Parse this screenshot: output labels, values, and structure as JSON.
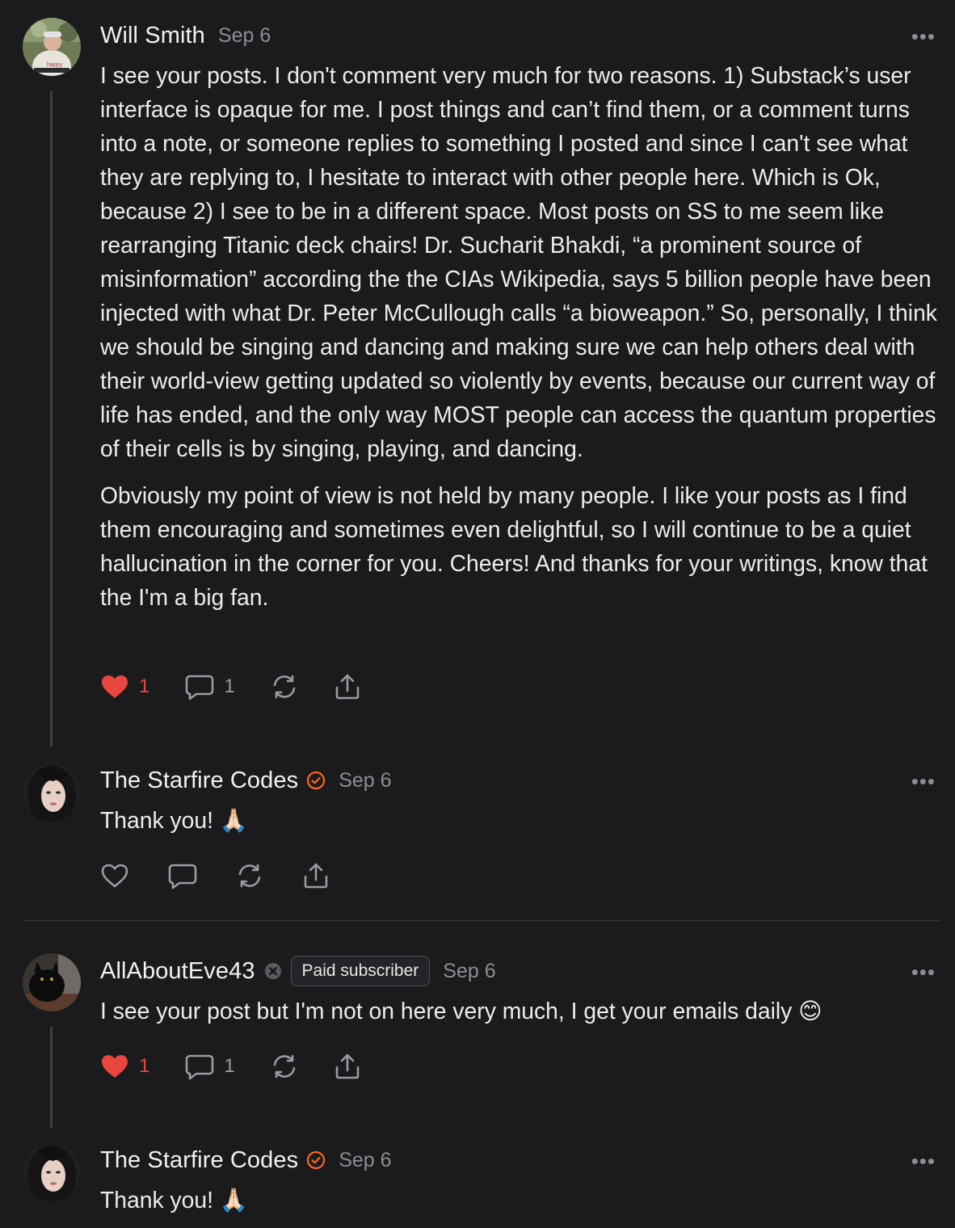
{
  "comments": [
    {
      "author": "Will Smith",
      "date": "Sep 6",
      "more": "•••",
      "paragraphs": [
        "I see your posts. I don't comment very much for two reasons. 1) Substack’s user interface is opaque for me. I post things and can’t find them, or a comment turns into a note, or someone replies to something I posted and since I can't see what they are replying to, I hesitate to interact with other people here. Which is Ok, because 2) I see to be in a different space. Most posts on SS to me seem like rearranging Titanic deck chairs! Dr. Sucharit Bhakdi, “a prominent source of misinformation” according the the CIAs Wikipedia, says 5 billion people have been injected with what Dr. Peter McCullough calls “a bioweapon.” So, personally, I think we should be singing and dancing and making sure we can help others deal with their world-view getting updated so violently by events, because our current way of life has ended, and the only way MOST people can access the quantum properties of their cells is by singing, playing, and dancing.",
        "Obviously my point of view is not held by many people. I like your posts as I find them encouraging and sometimes even delightful, so I will continue to be a quiet hallucination in the corner for you. Cheers! And thanks for your writings, know that the I'm a big fan."
      ],
      "likes": "1",
      "replies": "1",
      "liked": true
    },
    {
      "author": "The Starfire Codes",
      "date": "Sep 6",
      "more": "•••",
      "text": "Thank you! 🙏🏻",
      "badge": "verified-check-icon",
      "liked": false
    },
    {
      "author": "AllAboutEve43",
      "date": "Sep 6",
      "more": "•••",
      "badge": "subscriber-icon",
      "paid_label": "Paid subscriber",
      "text": "I see your post but I'm not on here very much, I get your emails daily 😊",
      "likes": "1",
      "replies": "1",
      "liked": true
    },
    {
      "author": "The Starfire Codes",
      "date": "Sep 6",
      "more": "•••",
      "text": "Thank you! 🙏🏻",
      "badge": "verified-check-icon"
    }
  ],
  "colors": {
    "background": "#1b1b1e",
    "accent": "#ff6719",
    "like": "#e8463f",
    "muted": "#8c8c92"
  }
}
